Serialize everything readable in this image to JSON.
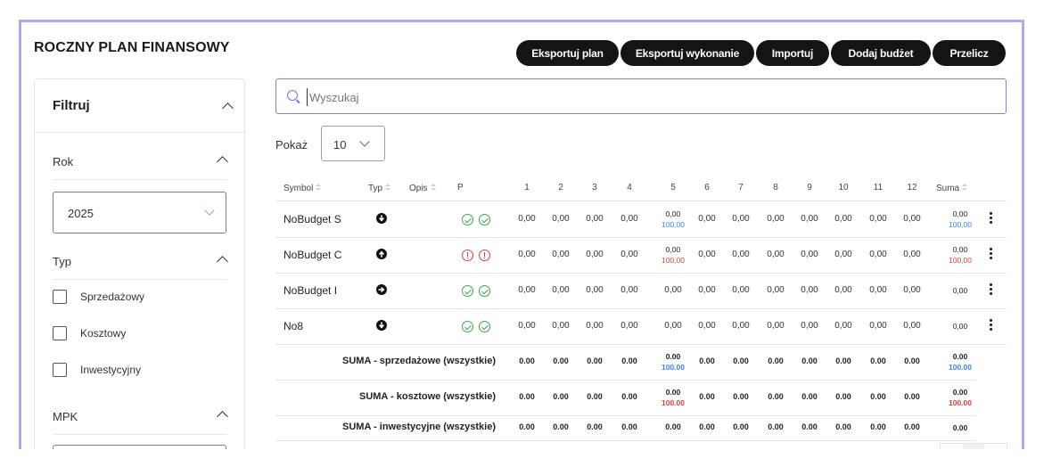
{
  "page": {
    "title": "ROCZNY PLAN FINANSOWY"
  },
  "actions": [
    "Eksportuj plan",
    "Eksportuj wykonanie",
    "Importuj",
    "Dodaj budżet",
    "Przelicz"
  ],
  "filter": {
    "title": "Filtruj",
    "year_label": "Rok",
    "year_value": "2025",
    "type_label": "Typ",
    "types": [
      "Sprzedażowy",
      "Kosztowy",
      "Inwestycyjny"
    ],
    "mpk_label": "MPK"
  },
  "search": {
    "placeholder": "Wyszukaj",
    "value": ""
  },
  "show": {
    "label": "Pokaż",
    "value": "10"
  },
  "table": {
    "headers": {
      "symbol": "Symbol",
      "typ": "Typ",
      "opis": "Opis",
      "p": "P",
      "months": [
        "1",
        "2",
        "3",
        "4",
        "5",
        "6",
        "7",
        "8",
        "9",
        "10",
        "11",
        "12"
      ],
      "suma": "Suma"
    },
    "rows": [
      {
        "symbol": "NoBudget S",
        "type_icon": "arrow-down-circle-icon",
        "status": [
          "ok",
          "ok"
        ],
        "months": [
          "0,00",
          "0,00",
          "0,00",
          "0,00",
          "0,00",
          "0,00",
          "0,00",
          "0,00",
          "0,00",
          "0,00",
          "0,00",
          "0,00"
        ],
        "m5_sub": "100,00",
        "m5_sub_color": "#3b82f6",
        "suma": "0,00",
        "suma_sub": "100,00",
        "suma_sub_color": "#3b82f6"
      },
      {
        "symbol": "NoBudget C",
        "type_icon": "arrow-up-circle-icon",
        "status": [
          "err",
          "err"
        ],
        "months": [
          "0,00",
          "0,00",
          "0,00",
          "0,00",
          "0,00",
          "0,00",
          "0,00",
          "0,00",
          "0,00",
          "0,00",
          "0,00",
          "0,00"
        ],
        "m5_sub": "100,00",
        "m5_sub_color": "#e03b3b",
        "suma": "0,00",
        "suma_sub": "100,00",
        "suma_sub_color": "#e03b3b"
      },
      {
        "symbol": "NoBudget I",
        "type_icon": "arrow-right-circle-icon",
        "status": [
          "ok",
          "ok"
        ],
        "months": [
          "0,00",
          "0,00",
          "0,00",
          "0,00",
          "0,00",
          "0,00",
          "0,00",
          "0,00",
          "0,00",
          "0,00",
          "0,00",
          "0,00"
        ],
        "m5_sub": "",
        "m5_sub_color": "",
        "suma": "0,00",
        "suma_sub": "",
        "suma_sub_color": ""
      },
      {
        "symbol": "No8",
        "type_icon": "arrow-down-circle-icon",
        "status": [
          "ok",
          "ok"
        ],
        "months": [
          "0,00",
          "0,00",
          "0,00",
          "0,00",
          "0,00",
          "0,00",
          "0,00",
          "0,00",
          "0,00",
          "0,00",
          "0,00",
          "0,00"
        ],
        "m5_sub": "",
        "m5_sub_color": "",
        "suma": "0,00",
        "suma_sub": "",
        "suma_sub_color": ""
      }
    ],
    "sums": [
      {
        "label": "SUMA - sprzedażowe (wszystkie)",
        "months": [
          "0.00",
          "0.00",
          "0.00",
          "0.00",
          "0.00",
          "0.00",
          "0.00",
          "0.00",
          "0.00",
          "0.00",
          "0.00",
          "0.00"
        ],
        "m5_sub": "100.00",
        "m5_sub_color": "#3b82f6",
        "suma": "0.00",
        "suma_sub": "100.00",
        "suma_sub_color": "#3b82f6"
      },
      {
        "label": "SUMA - kosztowe (wszystkie)",
        "months": [
          "0.00",
          "0.00",
          "0.00",
          "0.00",
          "0.00",
          "0.00",
          "0.00",
          "0.00",
          "0.00",
          "0.00",
          "0.00",
          "0.00"
        ],
        "m5_sub": "100.00",
        "m5_sub_color": "#e03b3b",
        "suma": "0.00",
        "suma_sub": "100.00",
        "suma_sub_color": "#e03b3b"
      },
      {
        "label": "SUMA - inwestycyjne (wszystkie)",
        "months": [
          "0.00",
          "0.00",
          "0.00",
          "0.00",
          "0.00",
          "0.00",
          "0.00",
          "0.00",
          "0.00",
          "0.00",
          "0.00",
          "0.00"
        ],
        "m5_sub": "",
        "m5_sub_color": "",
        "suma": "0.00",
        "suma_sub": "",
        "suma_sub_color": ""
      }
    ]
  },
  "colors": {
    "accent": "#b4a6ee",
    "button": "#141414",
    "ok": "#3aaa4c",
    "error": "#e03b3b",
    "info": "#3b82f6"
  }
}
